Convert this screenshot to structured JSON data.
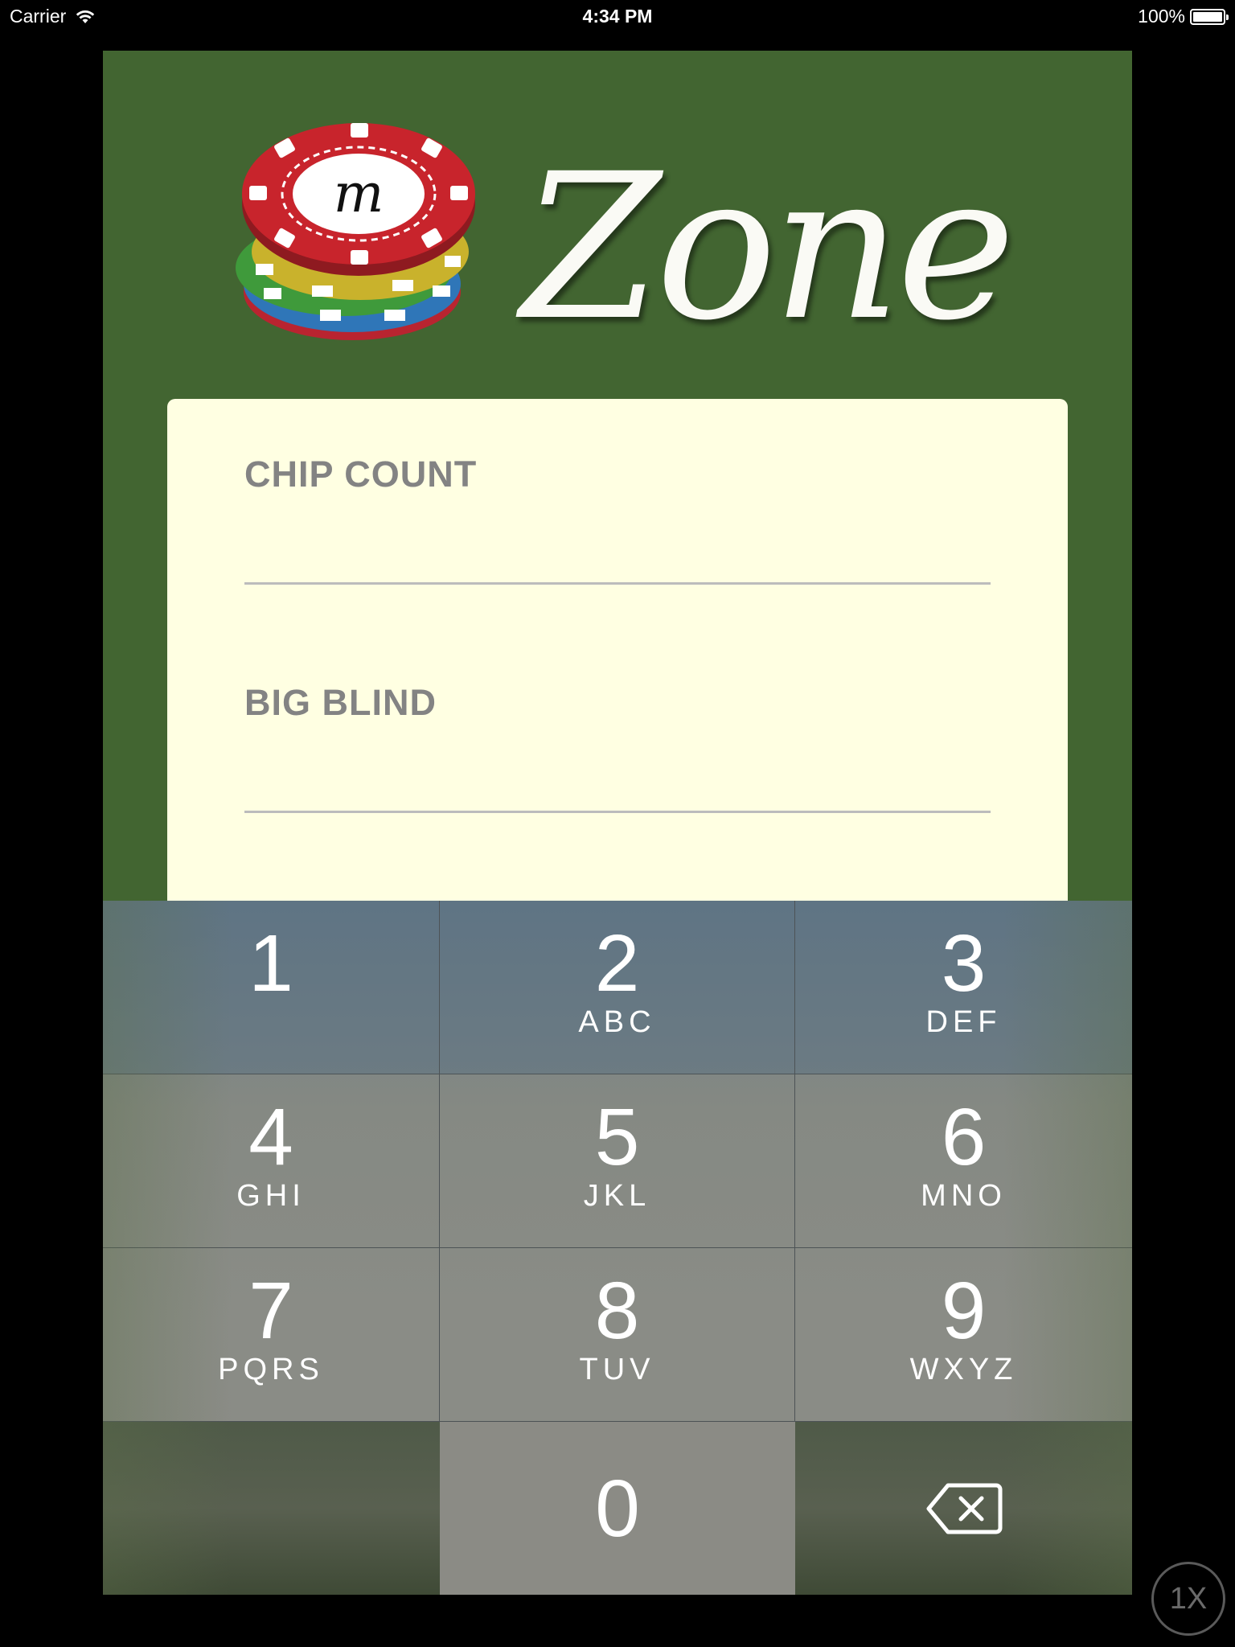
{
  "status_bar": {
    "carrier": "Carrier",
    "time": "4:34 PM",
    "battery": "100%"
  },
  "app": {
    "logo": {
      "chip_letter": "m",
      "wordmark": "Zone"
    },
    "form": {
      "chip_count_label": "CHIP COUNT",
      "chip_count_value": "",
      "big_blind_label": "BIG BLIND",
      "big_blind_value": ""
    }
  },
  "keypad": {
    "keys": [
      {
        "digit": "1",
        "letters": ""
      },
      {
        "digit": "2",
        "letters": "ABC"
      },
      {
        "digit": "3",
        "letters": "DEF"
      },
      {
        "digit": "4",
        "letters": "GHI"
      },
      {
        "digit": "5",
        "letters": "JKL"
      },
      {
        "digit": "6",
        "letters": "MNO"
      },
      {
        "digit": "7",
        "letters": "PQRS"
      },
      {
        "digit": "8",
        "letters": "TUV"
      },
      {
        "digit": "9",
        "letters": "WXYZ"
      },
      {
        "digit": "0",
        "letters": ""
      }
    ],
    "backspace_icon": "backspace-icon"
  },
  "zoom_badge": "1X",
  "colors": {
    "app_background": "#426531",
    "card_background": "#ffffe2",
    "label_color": "#838383",
    "chip_red": "#c8242c",
    "chip_yellow": "#c9b22c",
    "chip_green": "#3f9a3b",
    "chip_blue": "#2f76b8"
  }
}
